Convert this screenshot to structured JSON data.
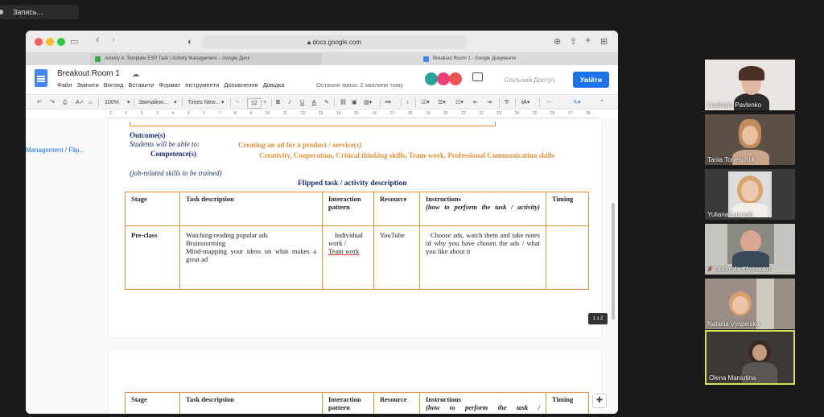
{
  "zoom": {
    "recording_label": "Запись..."
  },
  "browser": {
    "url": "docs.google.com",
    "tabs": [
      {
        "label": "Activity 4. Template ESP Task / Activity Management – Google Диск"
      },
      {
        "label": "Breakout Room 1 - Google Документи"
      }
    ]
  },
  "docs": {
    "title": "Breakout Room 1",
    "menus": [
      "Файл",
      "Змінити",
      "Вигляд",
      "Вставити",
      "Формат",
      "Інструменти",
      "Доповнення",
      "Довідка"
    ],
    "last_edit": "Остання зміна: 2 хвилини тому",
    "share_placeholder": "Спільний Доступ",
    "signin": "Увійти"
  },
  "toolbar": {
    "zoom": "100%",
    "style": "Звичайни...",
    "font": "Times New...",
    "font_size": "12"
  },
  "ruler_marks": [
    "1",
    "1",
    "2",
    "3",
    "4",
    "5",
    "6",
    "7",
    "8",
    "9",
    "10",
    "11",
    "12",
    "13",
    "14",
    "15",
    "16",
    "17",
    "18",
    "19",
    "20",
    "21",
    "22",
    "23",
    "24",
    "25",
    "26",
    "27",
    "28"
  ],
  "outline": {
    "link": "Management / Flip..."
  },
  "document": {
    "outcome_heading": "Outcome(s)",
    "students_line": "Students will be able to:",
    "ad_line": "Creating an ad for a product / service(s)",
    "competence_label": "Competence(s)",
    "competence_value": "Creativity, Cooperation, Critical thinking skills, Team-work, Professional Communication skills",
    "job_note": "(job-related skills to be trained)",
    "flipped_title": "Flipped task / activity description",
    "table": {
      "headers": {
        "stage": "Stage",
        "task": "Task description",
        "interaction": "Interaction pattern",
        "resource": "Resource",
        "instructions": "Instructions",
        "instructions_sub": "(how to perform the task / activity)",
        "timing": "Timing"
      },
      "row": {
        "stage": "Pre-class",
        "task": "Watching/reading popular ads\nBrainstorming\nMind-mapping your ideas on what makes a great ad",
        "interaction_1": "Individual work /",
        "interaction_2": "Team work",
        "resource": "YouTube",
        "instructions": "Choose ads, watch them and take notes of why you have chosen the ads / what you like about it",
        "timing": ""
      }
    },
    "table2_headers": {
      "stage": "Stage",
      "task": "Task description",
      "interaction": "Interaction pattern",
      "resource": "Resource",
      "instructions": "Instructions",
      "instructions_sub": "(how to perform the task /",
      "timing": "Timing"
    },
    "page_badge": "1 з 2"
  },
  "participants": [
    {
      "name": "Liudmyla Pavlenko"
    },
    {
      "name": "Tania Tonenchuk"
    },
    {
      "name": "Yuliana Lavrysh"
    },
    {
      "name": "Liudmyla Klymenko",
      "muted": true
    },
    {
      "name": "Nataliia Vyspinska"
    },
    {
      "name": "Olena Maniutina",
      "active_speaker": true
    }
  ],
  "colors": {
    "accent": "#1a73e8",
    "table_border": "#e69138",
    "orange_text": "#e69138",
    "heading_blue": "#1c2e6e"
  }
}
